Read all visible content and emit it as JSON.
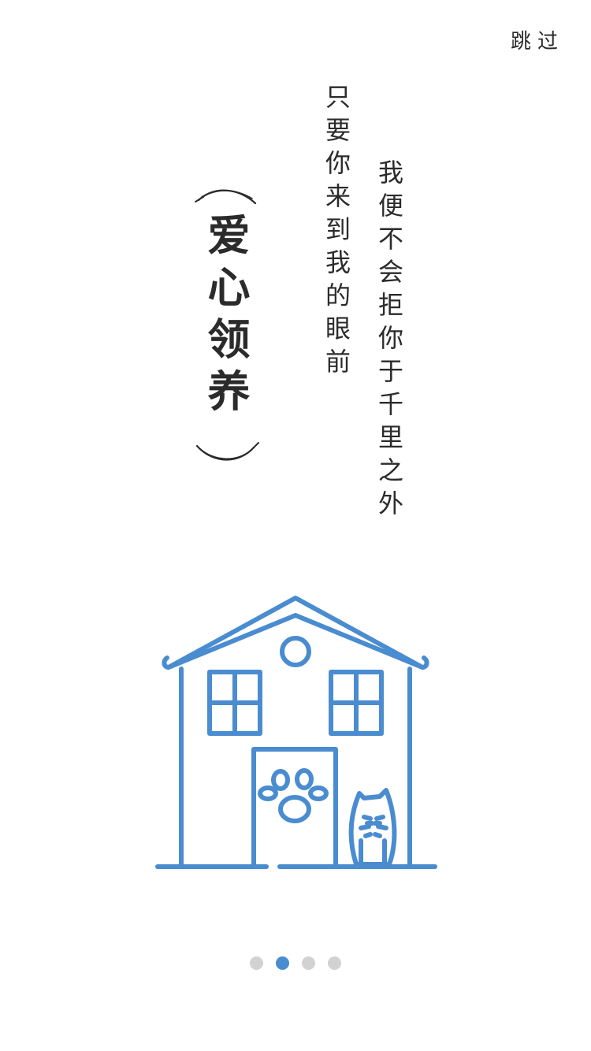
{
  "skip_label": "跳过",
  "title": "爱心领养",
  "poem": {
    "line1": "只要你来到我的眼前",
    "line2": "我便不会拒你于千里之外"
  },
  "illustration": {
    "name": "house-with-paw-and-cat",
    "color": "#4a8cd0"
  },
  "pagination": {
    "total": 4,
    "active_index": 1,
    "active_color": "#4a8cd0",
    "inactive_color": "#d2d2d2"
  }
}
